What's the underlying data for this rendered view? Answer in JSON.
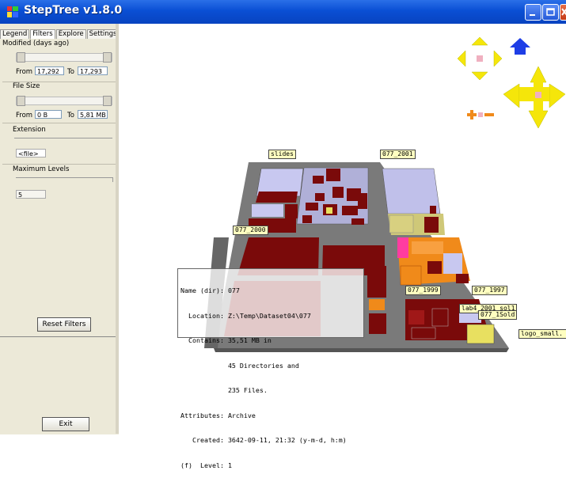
{
  "window": {
    "title": "StepTree v1.8.0"
  },
  "tabs": [
    {
      "label": "Legend"
    },
    {
      "label": "Filters"
    },
    {
      "label": "Explore"
    },
    {
      "label": "Settings"
    }
  ],
  "filters": {
    "modified_title": "Modified (days ago)",
    "modified_from_label": "From",
    "modified_from": "17,292",
    "modified_to_label": "To",
    "modified_to": "17,293",
    "filesize_title": "File Size",
    "filesize_from_label": "From",
    "filesize_from": "0 B",
    "filesize_to_label": "To",
    "filesize_to": "5,81 MB",
    "extension_title": "Extension",
    "extension_value": "<file>",
    "maxlevels_title": "Maximum Levels",
    "maxlevels_value": "5",
    "reset_label": "Reset Filters"
  },
  "exit_label": "Exit",
  "labels": {
    "slides": "slides",
    "d2001": "077_2001",
    "d2000": "077_2000",
    "d1999": "077_1999",
    "d1997": "077_1997",
    "lab4": "lab4_2001_sol1",
    "old": "077_1Sold",
    "logo": "logo_small."
  },
  "tooltip": {
    "lines": [
      "Name (dir): 077",
      "  Location: Z:\\Temp\\Dataset04\\077",
      "  Contains: 35,51 MB in",
      "            45 Directories and",
      "            235 Files.",
      "Attributes: Archive",
      "   Created: 3642-09-11, 21:32 (y-m-d, h:m)",
      "(f)  Level: 1"
    ]
  },
  "colors": {
    "dir": "#7a0a0a",
    "file_lavender": "#c8c8f0",
    "khaki": "#cfc878",
    "orange": "#f08a1a",
    "magenta": "#ff3ca0",
    "nav_yellow": "#f5e60a",
    "nav_blue": "#1e3ee6"
  },
  "nav_icons": [
    "arrow-up-icon",
    "arrow-down-icon",
    "arrow-left-icon",
    "arrow-right-icon",
    "home-icon",
    "zoom-in-icon",
    "zoom-out-icon",
    "rotate-icon"
  ]
}
